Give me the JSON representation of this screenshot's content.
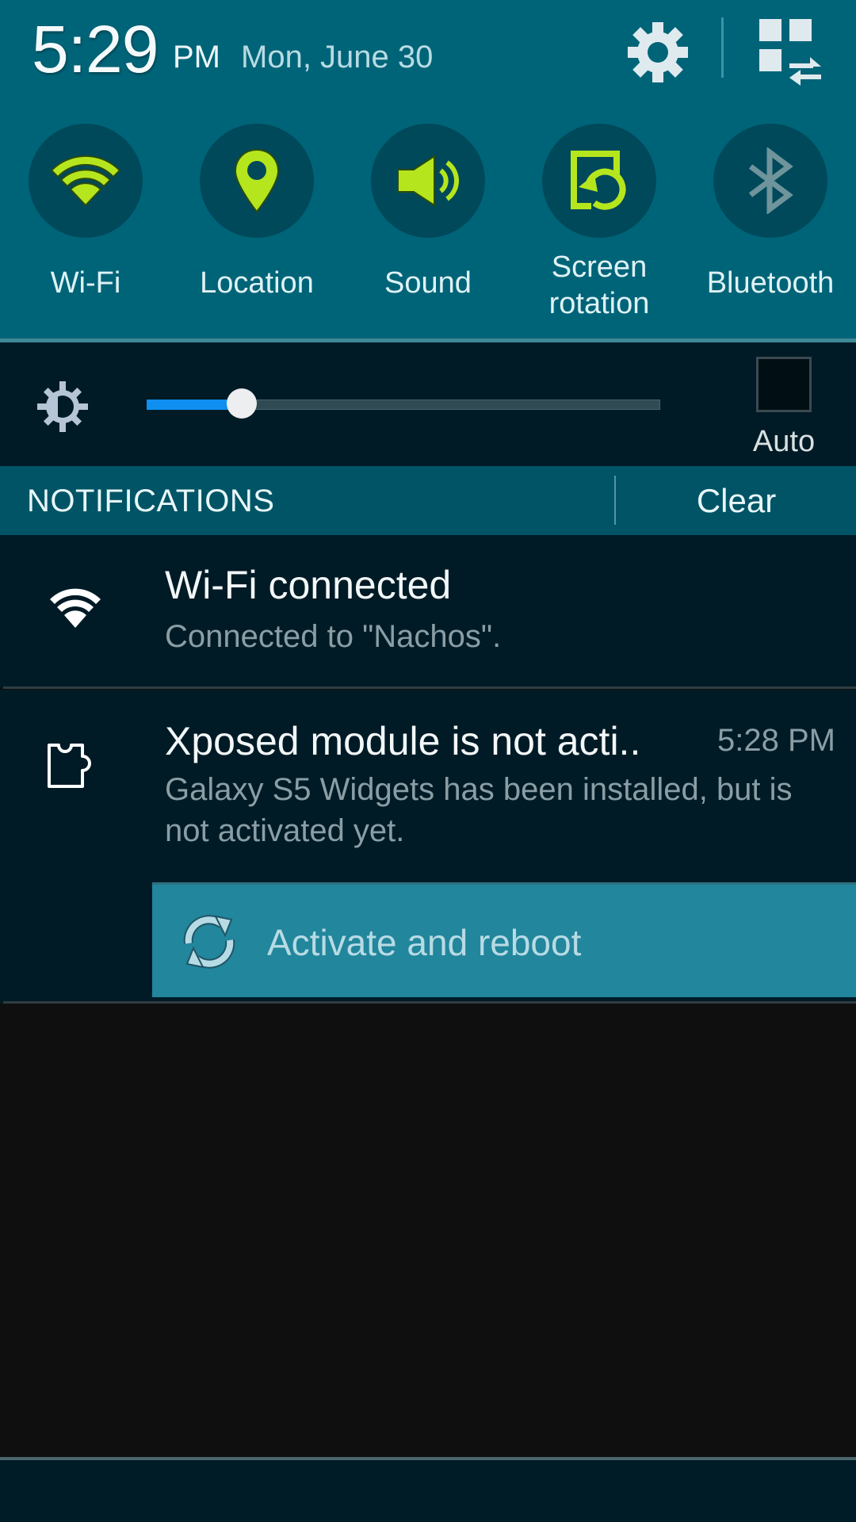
{
  "status_header": {
    "time": "5:29",
    "ampm": "PM",
    "date": "Mon, June 30",
    "settings_icon": "gear-icon",
    "edit_icon": "grid-swap-icon"
  },
  "quick_toggles": [
    {
      "label": "Wi-Fi",
      "icon": "wifi-icon",
      "state": "on"
    },
    {
      "label": "Location",
      "icon": "location-pin-icon",
      "state": "on"
    },
    {
      "label": "Sound",
      "icon": "speaker-icon",
      "state": "on"
    },
    {
      "label_line1": "Screen",
      "label_line2": "rotation",
      "icon": "screen-rotation-icon",
      "state": "on"
    },
    {
      "label": "Bluetooth",
      "icon": "bluetooth-icon",
      "state": "off"
    }
  ],
  "brightness": {
    "icon": "brightness-icon",
    "level": 0.185,
    "auto_label": "Auto",
    "auto_checked": false
  },
  "notifications_header": {
    "title": "NOTIFICATIONS",
    "clear_label": "Clear"
  },
  "notifications": [
    {
      "icon": "wifi-icon",
      "title": "Wi-Fi connected",
      "text": "Connected to \"Nachos\"."
    },
    {
      "icon": "puzzle-piece-icon",
      "title": "Xposed module is not acti..",
      "time": "5:28 PM",
      "text": "Galaxy S5 Widgets has been installed, but is not activated yet.",
      "action": {
        "icon": "refresh-icon",
        "label": "Activate and reboot"
      }
    }
  ],
  "colors": {
    "header_bg": "#006478",
    "toggle_on": "#b5e61d",
    "toggle_off": "#6f949c",
    "slider_fill": "#0f8ff0",
    "panel_bg": "#001b26",
    "notif_bar_bg": "#005465",
    "action_bg": "#22869c"
  }
}
